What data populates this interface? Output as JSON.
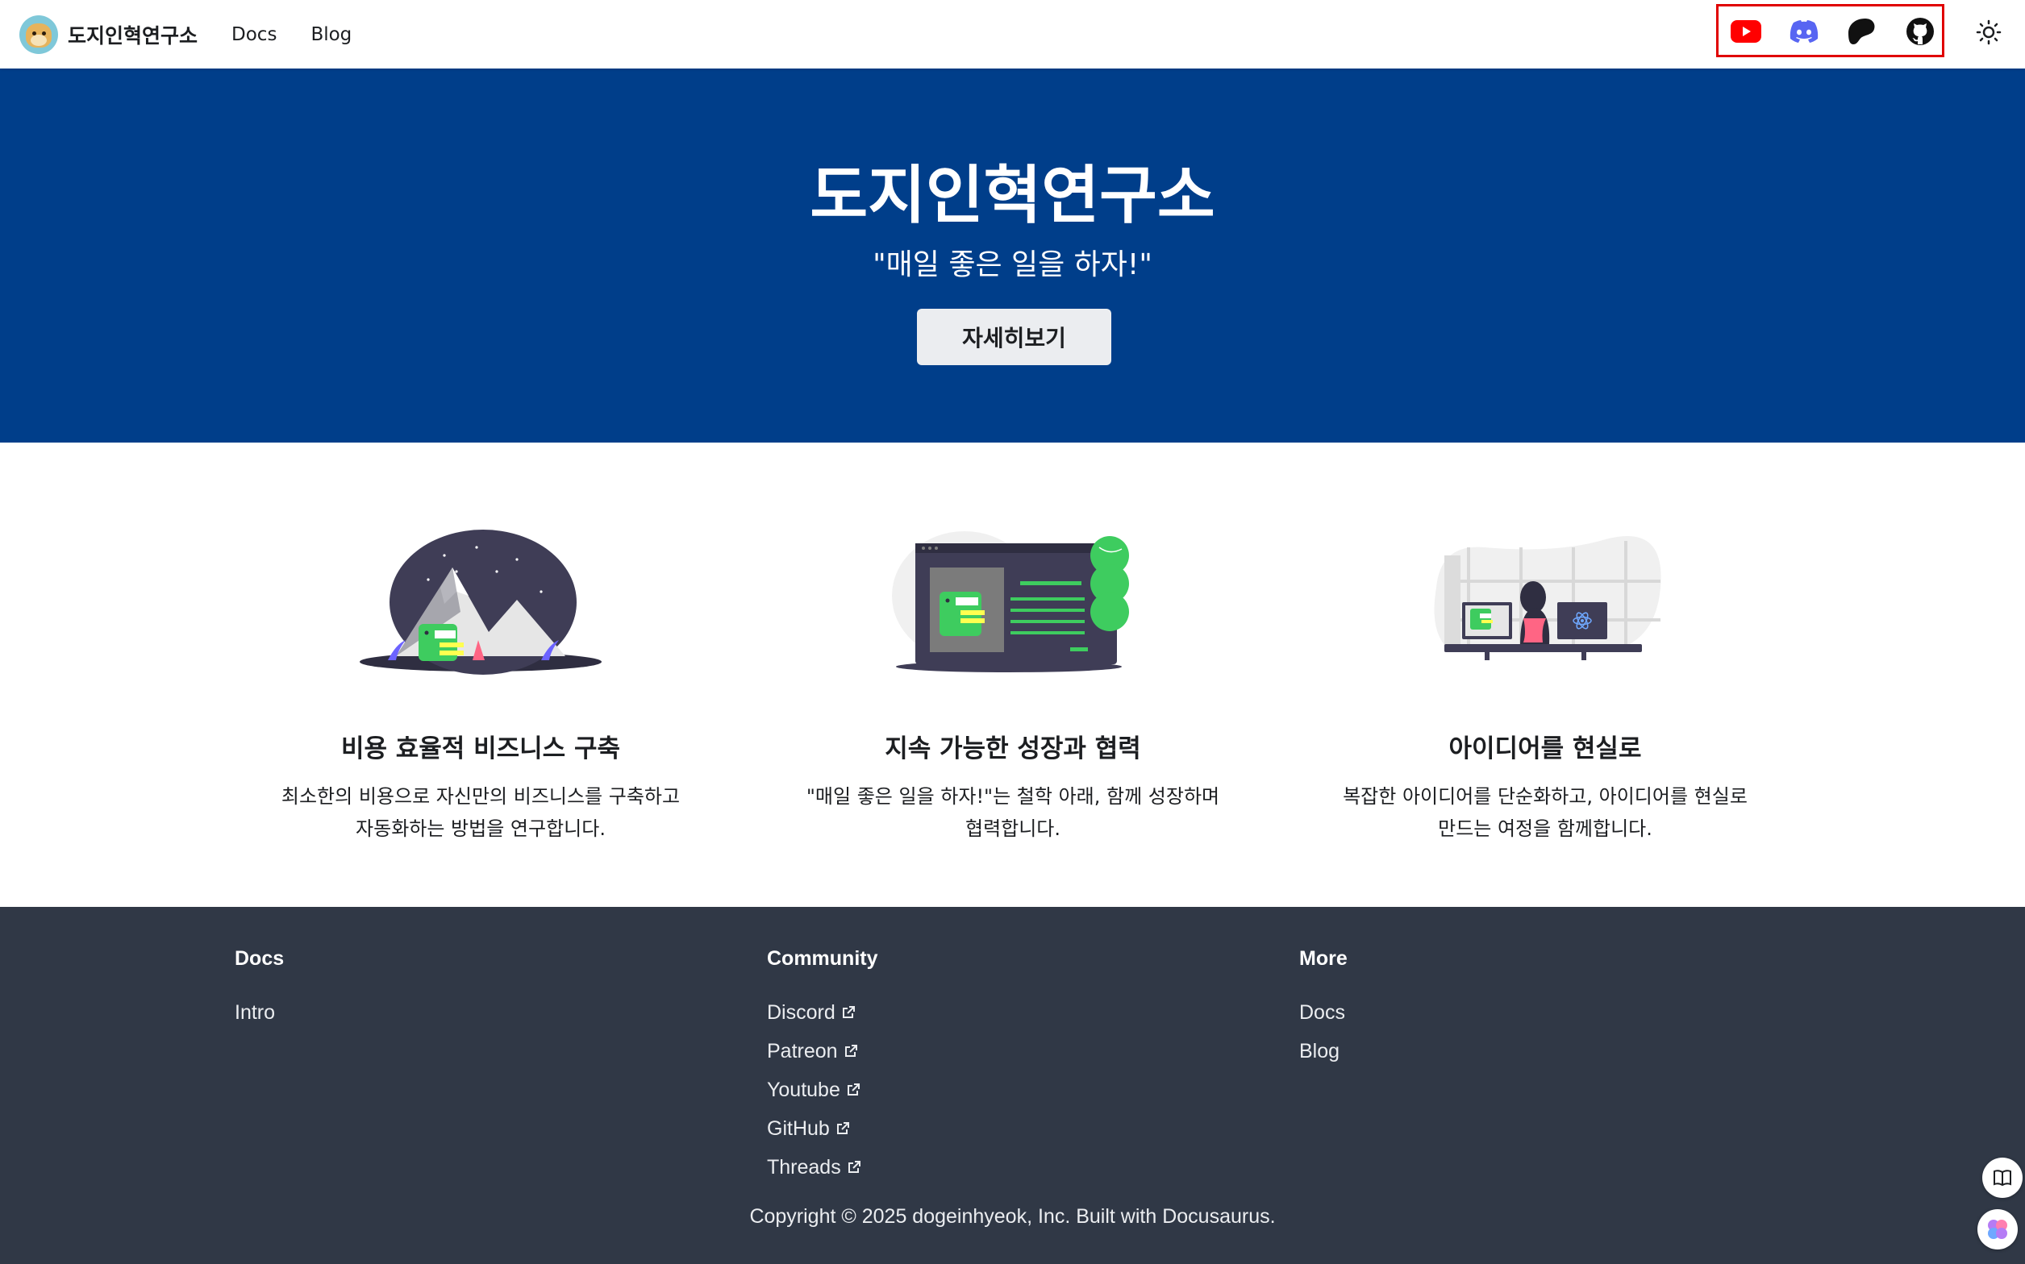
{
  "navbar": {
    "brand_title": "도지인혁연구소",
    "links": [
      {
        "label": "Docs"
      },
      {
        "label": "Blog"
      }
    ],
    "social_icons": [
      "youtube-icon",
      "discord-icon",
      "patreon-icon",
      "github-icon"
    ],
    "theme_icon": "sun-icon"
  },
  "hero": {
    "title": "도지인혁연구소",
    "subtitle": "\"매일 좋은 일을 하자!\"",
    "button_label": "자세히보기"
  },
  "features": [
    {
      "title": "비용 효율적 비즈니스 구축",
      "desc_line1": "최소한의 비용으로 자신만의 비즈니스를 구축하고",
      "desc_line2": "자동화하는 방법을 연구합니다."
    },
    {
      "title": "지속 가능한 성장과 협력",
      "desc_line1": "\"매일 좋은 일을 하자!\"는 철학 아래, 함께 성장하며",
      "desc_line2": "협력합니다."
    },
    {
      "title": "아이디어를 현실로",
      "desc_line1": "복잡한 아이디어를 단순화하고, 아이디어를 현실로",
      "desc_line2": "만드는 여정을 함께합니다."
    }
  ],
  "footer": {
    "columns": [
      {
        "title": "Docs",
        "links": [
          {
            "label": "Intro"
          }
        ]
      },
      {
        "title": "Community",
        "links": [
          {
            "label": "Discord"
          },
          {
            "label": "Patreon"
          },
          {
            "label": "Youtube"
          },
          {
            "label": "GitHub"
          },
          {
            "label": "Threads"
          }
        ]
      },
      {
        "title": "More",
        "links": [
          {
            "label": "Docs"
          },
          {
            "label": "Blog"
          }
        ]
      }
    ],
    "copyright": "Copyright © 2025 dogeinhyeok, Inc. Built with Docusaurus."
  },
  "colors": {
    "hero_bg": "#003e8a",
    "footer_bg": "#303846",
    "highlight_box": "#e00000",
    "youtube": "#ff0000",
    "discord": "#5865f2",
    "accent_green": "#3ecc5f"
  }
}
